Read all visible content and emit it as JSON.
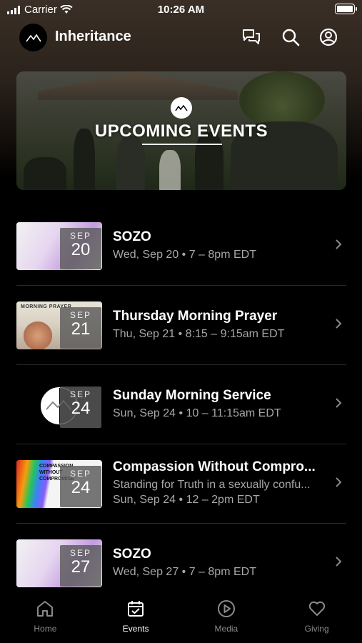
{
  "status_bar": {
    "carrier": "Carrier",
    "time": "10:26 AM"
  },
  "header": {
    "title": "Inheritance"
  },
  "banner": {
    "title": "UPCOMING EVENTS"
  },
  "events": [
    {
      "title": "SOZO",
      "month": "SEP",
      "day": "20",
      "subtitle": "Wed, Sep 20 • 7 – 8pm EDT",
      "subtitle2": ""
    },
    {
      "title": "Thursday Morning Prayer",
      "month": "SEP",
      "day": "21",
      "subtitle": "Thu, Sep 21 • 8:15 – 9:15am EDT",
      "subtitle2": "",
      "thumb_text": "MORNING PRAYER"
    },
    {
      "title": "Sunday Morning Service",
      "month": "SEP",
      "day": "24",
      "subtitle": "Sun, Sep 24 • 10 – 11:15am EDT",
      "subtitle2": ""
    },
    {
      "title": "Compassion Without Compro...",
      "month": "SEP",
      "day": "24",
      "subtitle": "Standing for Truth in a sexually confu...",
      "subtitle2": "Sun, Sep 24 • 12 – 2pm EDT",
      "thumb_text": "COMPASSION WITHOUT COMPROMISE"
    },
    {
      "title": "SOZO",
      "month": "SEP",
      "day": "27",
      "subtitle": "Wed, Sep 27 • 7 – 8pm EDT",
      "subtitle2": ""
    }
  ],
  "tabs": [
    {
      "label": "Home",
      "icon": "home-icon",
      "active": false
    },
    {
      "label": "Events",
      "icon": "calendar-icon",
      "active": true
    },
    {
      "label": "Media",
      "icon": "play-icon",
      "active": false
    },
    {
      "label": "Giving",
      "icon": "heart-icon",
      "active": false
    }
  ],
  "colors": {
    "background": "#000000",
    "text": "#ffffff",
    "muted": "#a8a8a8",
    "tab_inactive": "#8a8a8a"
  }
}
